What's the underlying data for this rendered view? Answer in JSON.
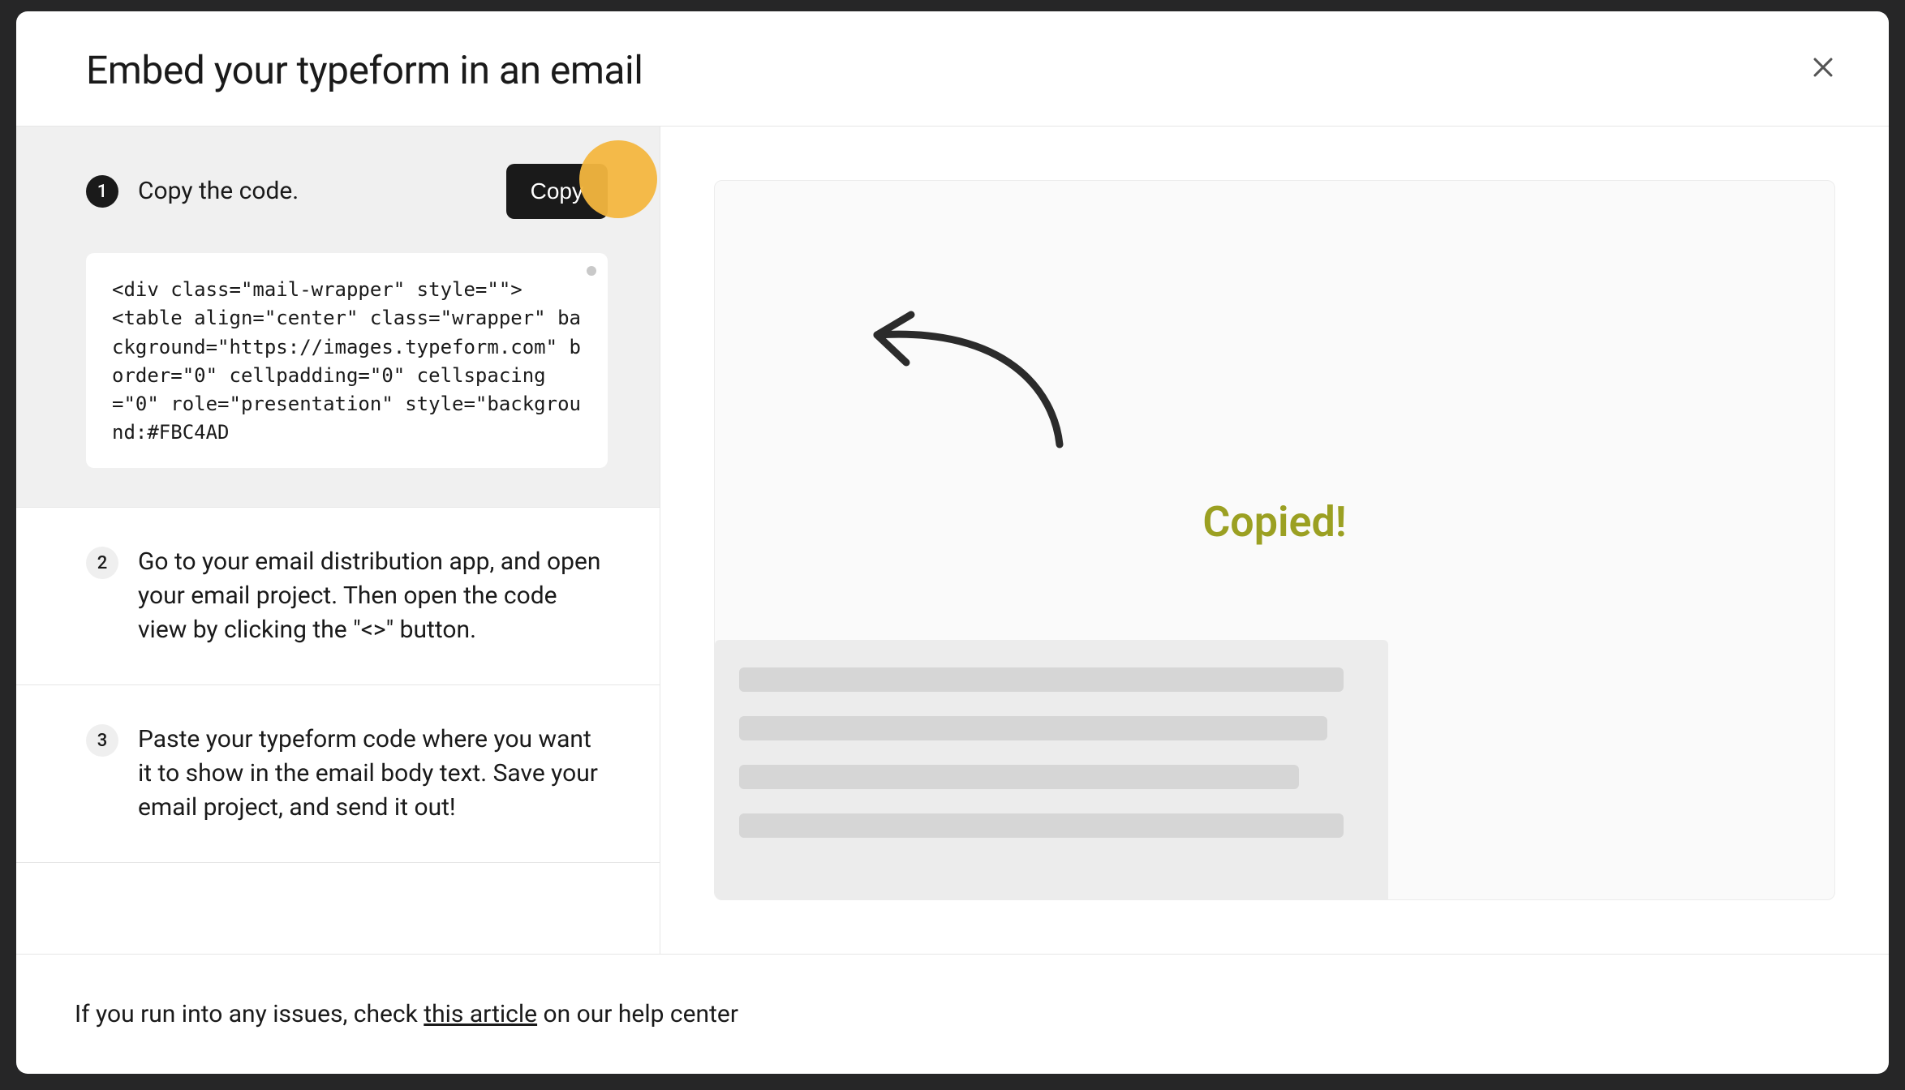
{
  "modal": {
    "title": "Embed your typeform in an email",
    "close_label": "Close"
  },
  "steps": {
    "s1": {
      "num": "1",
      "label": "Copy the code.",
      "copy_btn": "Copy"
    },
    "s2": {
      "num": "2",
      "text": "Go to your email distribution app, and open your email project. Then open the code view by clicking the \"<>\" button."
    },
    "s3": {
      "num": "3",
      "text": "Paste your typeform code where you want it to show in the email body text. Save your email project, and send it out!"
    }
  },
  "code_snippet": "<div class=\"mail-wrapper\" style=\"\">\n<table align=\"center\" class=\"wrapper\" background=\"https://images.typeform.com\" border=\"0\" cellpadding=\"0\" cellspacing=\"0\" role=\"presentation\" style=\"background:#FBC4AD",
  "preview": {
    "copied": "Copied!"
  },
  "footer": {
    "prefix": "If you run into any issues, check ",
    "link": "this article",
    "suffix": " on our help center"
  }
}
